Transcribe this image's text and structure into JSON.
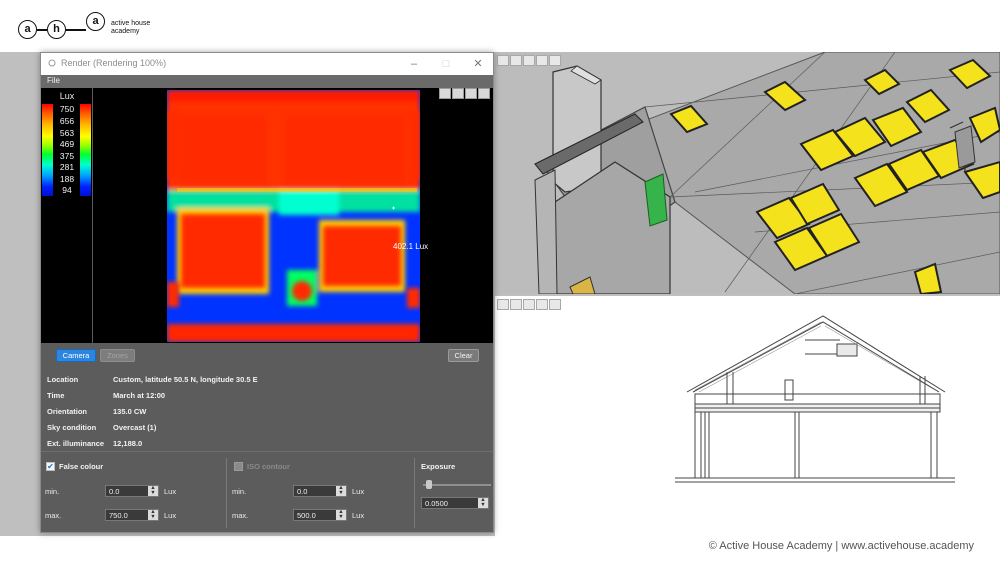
{
  "logo": {
    "letters": [
      "a",
      "h",
      "a"
    ],
    "text": "active house academy"
  },
  "window": {
    "title": "Render (Rendering 100%)",
    "menu": [
      "File"
    ]
  },
  "legend": {
    "title": "Lux",
    "values": [
      "750",
      "656",
      "563",
      "469",
      "375",
      "281",
      "188",
      "94"
    ]
  },
  "probe": {
    "label": "402.1 Lux"
  },
  "buttons": {
    "camera": "Camera",
    "zones": "Zones",
    "clear": "Clear"
  },
  "info": {
    "rows": [
      {
        "key": "Location",
        "value": "Custom, latitude 50.5 N, longitude 30.5 E"
      },
      {
        "key": "Time",
        "value": "March at 12:00"
      },
      {
        "key": "Orientation",
        "value": "135.0 CW"
      },
      {
        "key": "Sky condition",
        "value": "Overcast (1)"
      },
      {
        "key": "Ext. illuminance",
        "value": "12,188.0"
      }
    ]
  },
  "false_colour": {
    "label": "False colour",
    "checked": true,
    "min_label": "min.",
    "min_value": "0.0",
    "max_label": "max.",
    "max_value": "750.0",
    "unit": "Lux"
  },
  "iso_contour": {
    "label": "ISO contour",
    "checked": false,
    "min_label": "min.",
    "min_value": "0.0",
    "max_label": "max.",
    "max_value": "500.0",
    "unit": "Lux"
  },
  "exposure": {
    "label": "Exposure",
    "value": "0.0500"
  },
  "copyright": "© Active House Academy | www.activehouse.academy",
  "colors": {
    "accent": "#2a86e0",
    "panel": "#5c5c5c",
    "workspace": "#bfbfbf"
  }
}
